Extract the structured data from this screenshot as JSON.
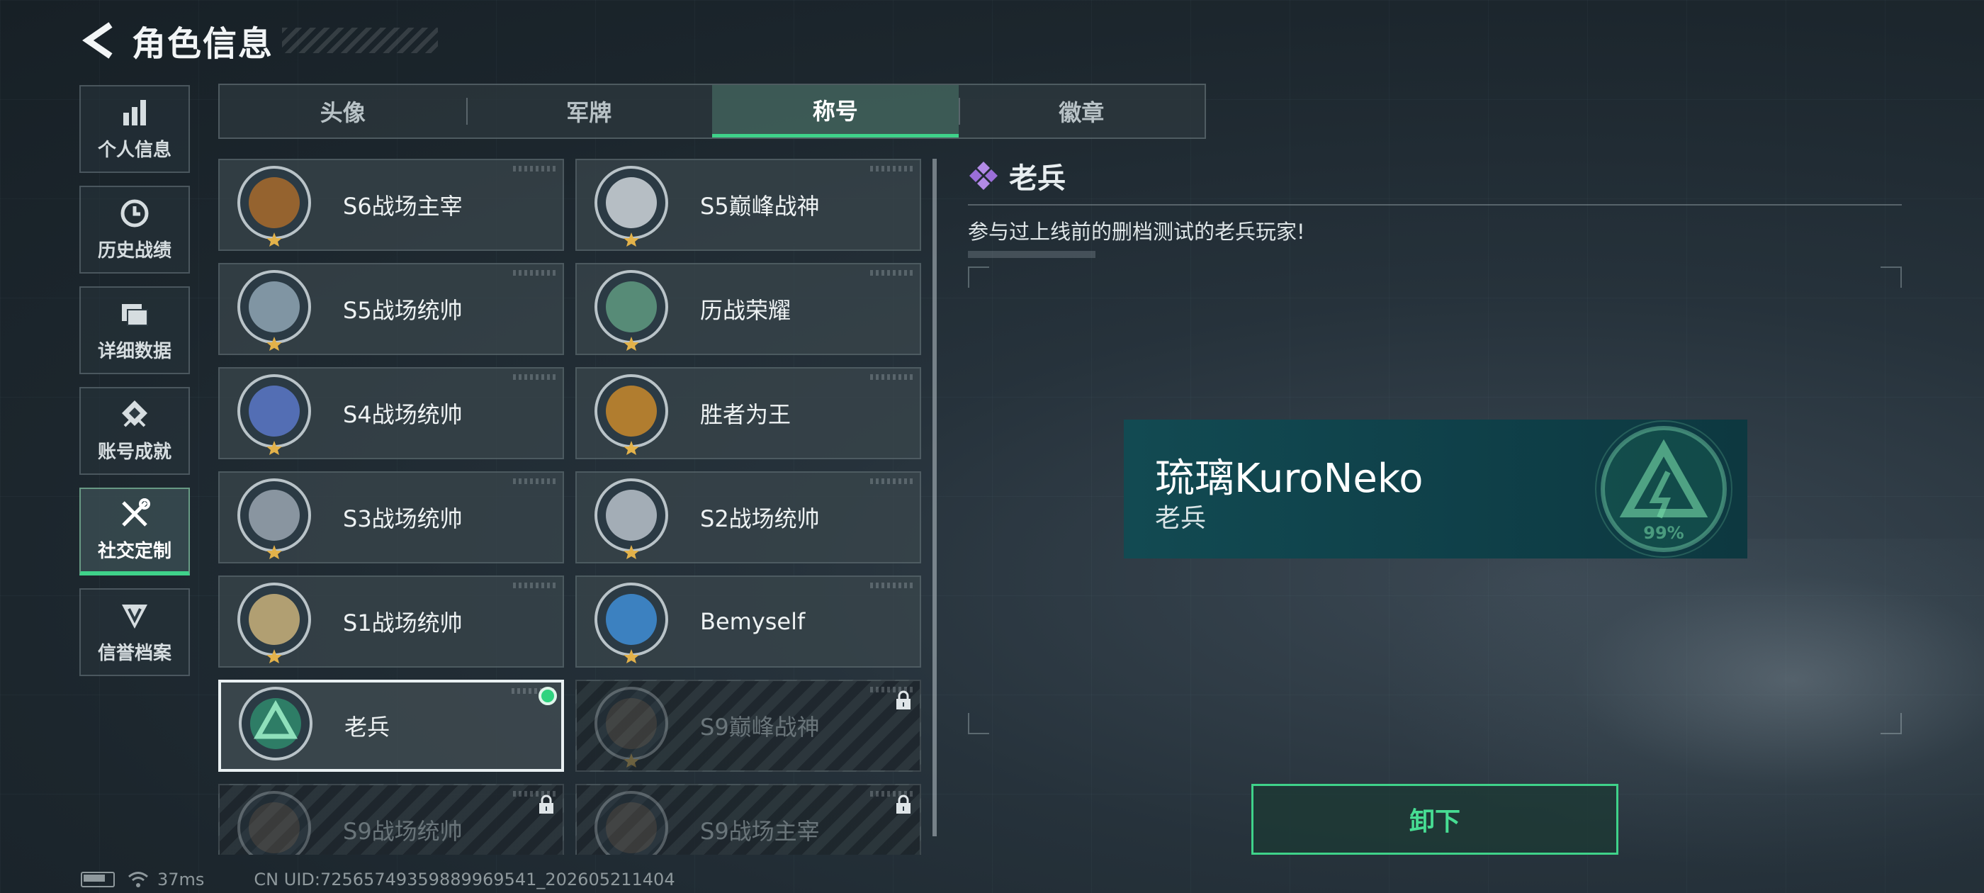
{
  "header": {
    "title": "角色信息"
  },
  "sidebar": {
    "items": [
      {
        "label": "个人信息",
        "icon": "bar-chart-icon",
        "active": false
      },
      {
        "label": "历史战绩",
        "icon": "clock-icon",
        "active": false
      },
      {
        "label": "详细数据",
        "icon": "folder-icon",
        "active": false
      },
      {
        "label": "账号成就",
        "icon": "achievement-icon",
        "active": false
      },
      {
        "label": "社交定制",
        "icon": "tools-icon",
        "active": true
      },
      {
        "label": "信誉档案",
        "icon": "shield-v-icon",
        "active": false
      }
    ]
  },
  "tabs": [
    {
      "label": "头像",
      "active": false
    },
    {
      "label": "军牌",
      "active": false
    },
    {
      "label": "称号",
      "active": true
    },
    {
      "label": "徽章",
      "active": false
    }
  ],
  "titles": [
    {
      "label": "S6战场主宰",
      "badge": "crossed-guns-badge-icon",
      "color": "#a86b2c",
      "state": "unlocked"
    },
    {
      "label": "S5巅峰战神",
      "badge": "skull-mask-badge-icon",
      "color": "#cfd6da",
      "state": "unlocked"
    },
    {
      "label": "S5战场统帅",
      "badge": "boat-badge-icon",
      "color": "#8fa6b4",
      "state": "unlocked"
    },
    {
      "label": "历战荣耀",
      "badge": "trophy-badge-icon",
      "color": "#5f9a80",
      "state": "unlocked"
    },
    {
      "label": "S4战场统帅",
      "badge": "missile-badge-icon",
      "color": "#5a78c8",
      "state": "unlocked"
    },
    {
      "label": "胜者为王",
      "badge": "star-medal-badge-icon",
      "color": "#c98a2c",
      "state": "unlocked"
    },
    {
      "label": "S3战场统帅",
      "badge": "vehicle-badge-icon",
      "color": "#9aa6b0",
      "state": "unlocked"
    },
    {
      "label": "S2战场统帅",
      "badge": "helicopter-badge-icon",
      "color": "#b8c2ca",
      "state": "unlocked"
    },
    {
      "label": "S1战场统帅",
      "badge": "tank-badge-icon",
      "color": "#c9b27a",
      "state": "unlocked"
    },
    {
      "label": "Bemyself",
      "badge": "signature-badge-icon",
      "color": "#3f8ed6",
      "state": "unlocked"
    },
    {
      "label": "老兵",
      "badge": "veteran-badge-icon",
      "color": "#2f8a6c",
      "state": "equipped"
    },
    {
      "label": "S9巅峰战神",
      "badge": "ruins-badge-icon",
      "color": "#7a6a58",
      "state": "locked"
    },
    {
      "label": "S9战场统帅",
      "badge": "ship-badge-icon",
      "color": "#7a6a58",
      "state": "locked"
    },
    {
      "label": "S9战场主宰",
      "badge": "mushroom-cloud-badge-icon",
      "color": "#7a6a58",
      "state": "locked"
    }
  ],
  "detail": {
    "name": "老兵",
    "description": "参与过上线前的删档测试的老兵玩家!",
    "icon": "diamond-cluster-icon"
  },
  "preview": {
    "player_name": "琉璃KuroNeko",
    "title": "老兵",
    "emblem_text": "99%"
  },
  "actions": {
    "unequip_label": "卸下"
  },
  "footer": {
    "ping": "37ms",
    "uid": "CN UID:72565749359889969541_202605211404"
  },
  "colors": {
    "accent": "#3fd28a",
    "plate": "#124a52"
  }
}
